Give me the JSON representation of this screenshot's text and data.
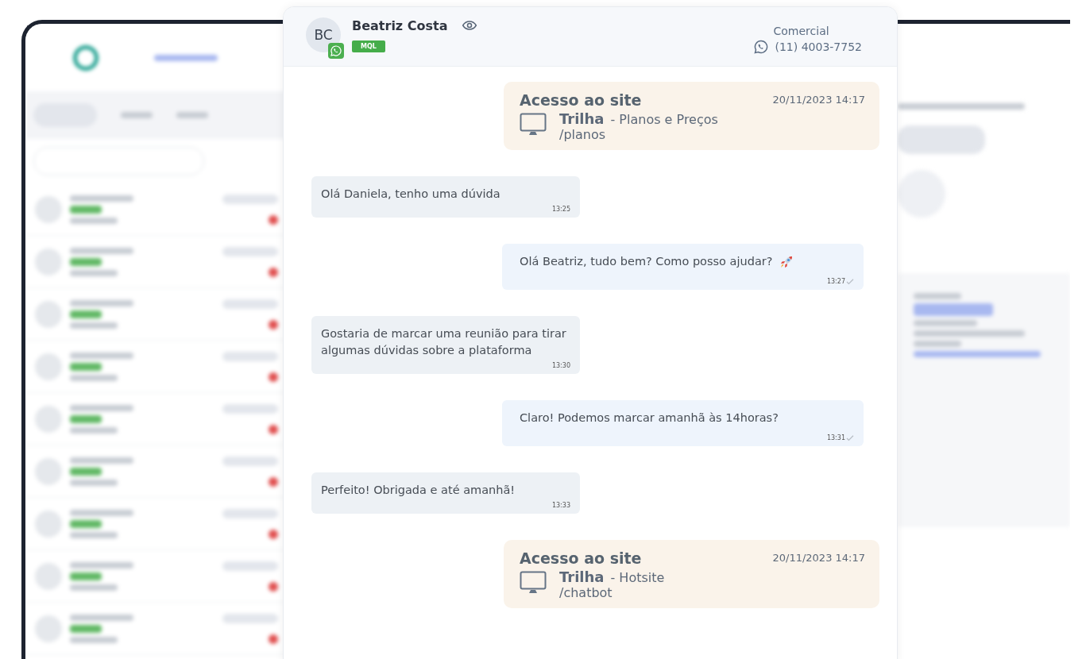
{
  "contact": {
    "initials": "BC",
    "name": "Beatriz Costa",
    "tag": "MQL",
    "channel_label": "Comercial",
    "phone": "(11) 4003-7752"
  },
  "messages": [
    {
      "kind": "event",
      "title": "Acesso ao site",
      "datetime": "20/11/2023 14:17",
      "track": "Trilha",
      "page": "- Planos e Preços",
      "path": "/planos"
    },
    {
      "kind": "incoming",
      "text": "Olá Daniela, tenho uma dúvida",
      "time": "13:25"
    },
    {
      "kind": "outgoing",
      "text": "Olá Beatriz, tudo bem? Como posso ajudar?",
      "rocket": true,
      "time": "13:27"
    },
    {
      "kind": "incoming",
      "text": "Gostaria de marcar uma reunião para tirar algumas dúvidas sobre a plataforma",
      "time": "13:30"
    },
    {
      "kind": "outgoing",
      "text": "Claro! Podemos marcar amanhã às 14horas?",
      "time": "13:31"
    },
    {
      "kind": "incoming",
      "text": "Perfeito! Obrigada e até amanhã!",
      "time": "13:33"
    },
    {
      "kind": "event",
      "title": "Acesso ao site",
      "datetime": "20/11/2023 14:17",
      "track": "Trilha",
      "page": "- Hotsite",
      "path": "/chatbot"
    }
  ]
}
